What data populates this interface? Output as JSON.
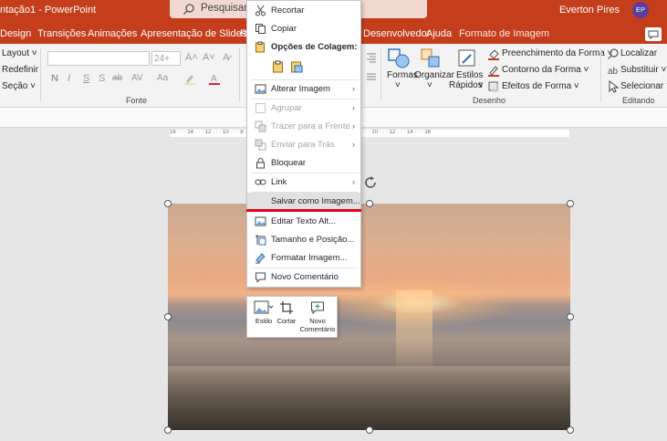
{
  "titlebar": {
    "title": "ntação1  -  PowerPoint",
    "search_placeholder": "Pesquisar (Al",
    "user_name": "Everton Pires",
    "avatar_initials": "EP",
    "bg_color": "#c43e1c"
  },
  "tabs": [
    {
      "label": "Design"
    },
    {
      "label": "Transições"
    },
    {
      "label": "Animações"
    },
    {
      "label": "Apresentação de Slides"
    },
    {
      "label": "Re"
    },
    {
      "label": "Desenvolvedor"
    },
    {
      "label": "Ajuda"
    },
    {
      "label": "Formato de Imagem"
    }
  ],
  "ribbon": {
    "layout": "Layout",
    "redefinir": "Redefinir",
    "secao": "Seção",
    "font_size": "24+",
    "fonte_group": "Fonte",
    "formas": "Formas",
    "organizar": "Organizar",
    "estilos": "Estilos",
    "rapidos": "Rápidos",
    "preenchimento": "Preenchimento da Forma",
    "contorno": "Contorno da Forma",
    "efeitos": "Efeitos de Forma",
    "desenho_group": "Desenho",
    "localizar": "Localizar",
    "substituir": "Substituir",
    "selecionar": "Selecionar",
    "editando_group": "Editando",
    "format_buttons": [
      "N",
      "I",
      "S",
      "S",
      "ab",
      "AV",
      "Aa"
    ]
  },
  "ruler_text": "16 · · · 14 · · · 12 · · · 10 · · · 8 · · · 6 · · · 4 · · · 2 · · · 0 · · · 2 · · · 4 · · · 6 · · · 8 · · · 10 · · · 12 · · · 14 · · · 16",
  "context_menu": {
    "items": [
      {
        "label": "Recortar",
        "icon": "scissors-icon"
      },
      {
        "label": "Copiar",
        "icon": "copy-icon"
      },
      {
        "label": "Opções de Colagem:",
        "icon": "paste-icon"
      },
      {
        "label": "Alterar Imagem",
        "icon": "change-picture-icon",
        "submenu": true
      },
      {
        "label": "Agrupar",
        "icon": "group-icon",
        "submenu": true,
        "disabled": true
      },
      {
        "label": "Trazer para a Frente",
        "icon": "bring-forward-icon",
        "submenu": true,
        "disabled": true
      },
      {
        "label": "Enviar para Trás",
        "icon": "send-backward-icon",
        "submenu": true,
        "disabled": true
      },
      {
        "label": "Bloquear",
        "icon": "lock-icon"
      },
      {
        "label": "Link",
        "icon": "link-icon",
        "submenu": true
      },
      {
        "label": "Salvar como Imagem...",
        "icon": "",
        "highlighted": true
      },
      {
        "label": "Editar Texto Alt...",
        "icon": "alt-text-icon"
      },
      {
        "label": "Tamanho e Posição...",
        "icon": "size-position-icon"
      },
      {
        "label": "Formatar Imagem...",
        "icon": "format-picture-icon"
      },
      {
        "label": "Novo Comentário",
        "icon": "comment-icon"
      }
    ],
    "highlight_underline_color": "#e2001a"
  },
  "mini_toolbar": {
    "buttons": [
      {
        "label": "Estilo"
      },
      {
        "label": "Cortar"
      },
      {
        "label": "Novo",
        "label2": "Comentário"
      }
    ]
  }
}
